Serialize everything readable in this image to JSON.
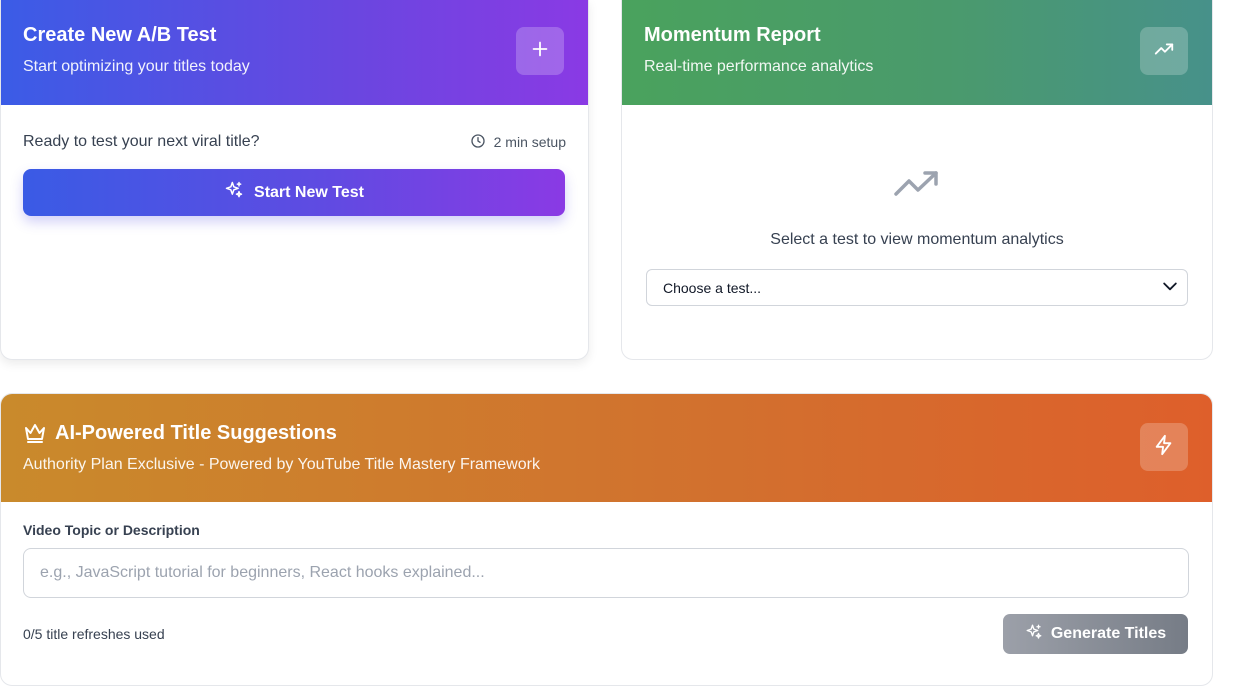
{
  "create_card": {
    "title": "Create New A/B Test",
    "subtitle": "Start optimizing your titles today",
    "add_icon": "plus-icon",
    "ready_text": "Ready to test your next viral title?",
    "setup_time": "2 min setup",
    "start_button_label": "Start New Test",
    "gradient": [
      "#3b5ce6",
      "#8a3ae4"
    ]
  },
  "momentum_card": {
    "title": "Momentum Report",
    "subtitle": "Real-time performance analytics",
    "header_icon": "trending-up-icon",
    "empty_message": "Select a test to view momentum analytics",
    "select_value": "Choose a test...",
    "gradient": [
      "#4aa25d",
      "#47918a"
    ]
  },
  "ai_card": {
    "title": "AI-Powered Title Suggestions",
    "subtitle": "Authority Plan Exclusive - Powered by YouTube Title Mastery Framework",
    "title_icon": "crown-icon",
    "header_icon": "lightning-icon",
    "field_label": "Video Topic or Description",
    "input_placeholder": "e.g., JavaScript tutorial for beginners, React hooks explained...",
    "input_value": "",
    "refresh_count": "0/5 title refreshes used",
    "generate_button_label": "Generate Titles",
    "gradient": [
      "#c98a2c",
      "#de5f2b"
    ]
  }
}
